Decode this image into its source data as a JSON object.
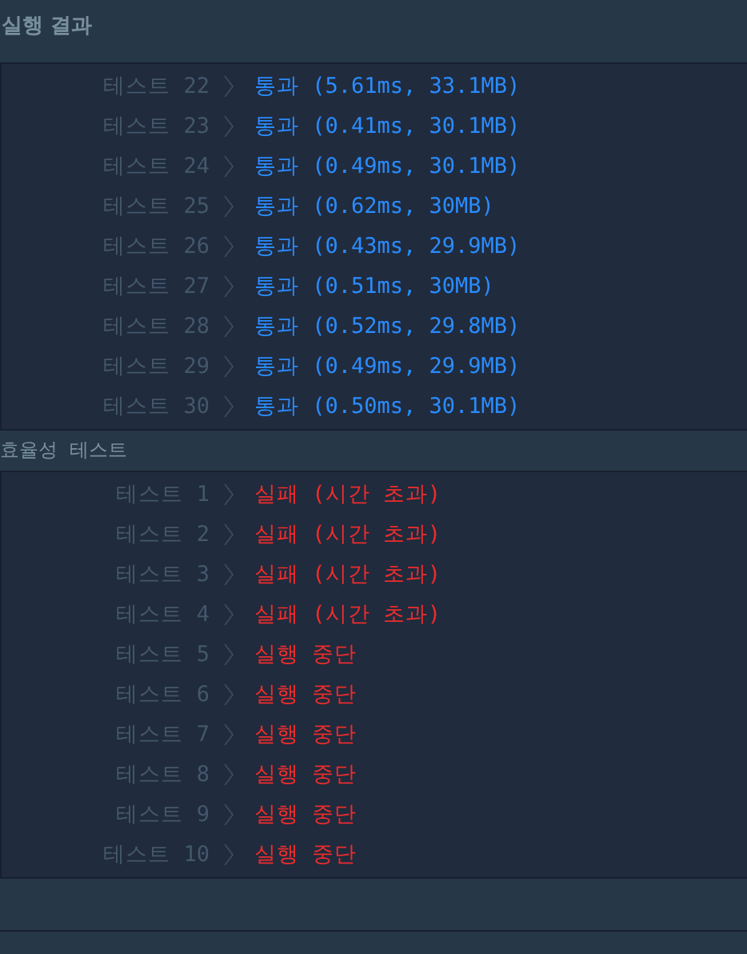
{
  "header": {
    "title": "실행 결과"
  },
  "sections": [
    {
      "tests": [
        {
          "label": "테스트 22",
          "kind": "pass",
          "result": "통과 (5.61ms, 33.1MB)"
        },
        {
          "label": "테스트 23",
          "kind": "pass",
          "result": "통과 (0.41ms, 30.1MB)"
        },
        {
          "label": "테스트 24",
          "kind": "pass",
          "result": "통과 (0.49ms, 30.1MB)"
        },
        {
          "label": "테스트 25",
          "kind": "pass",
          "result": "통과 (0.62ms, 30MB)"
        },
        {
          "label": "테스트 26",
          "kind": "pass",
          "result": "통과 (0.43ms, 29.9MB)"
        },
        {
          "label": "테스트 27",
          "kind": "pass",
          "result": "통과 (0.51ms, 30MB)"
        },
        {
          "label": "테스트 28",
          "kind": "pass",
          "result": "통과 (0.52ms, 29.8MB)"
        },
        {
          "label": "테스트 29",
          "kind": "pass",
          "result": "통과 (0.49ms, 29.9MB)"
        },
        {
          "label": "테스트 30",
          "kind": "pass",
          "result": "통과 (0.50ms, 30.1MB)"
        }
      ]
    },
    {
      "title": "효율성  테스트",
      "tests": [
        {
          "label": "테스트 1",
          "kind": "fail",
          "result": "실패 (시간 초과)"
        },
        {
          "label": "테스트 2",
          "kind": "fail",
          "result": "실패 (시간 초과)"
        },
        {
          "label": "테스트 3",
          "kind": "fail",
          "result": "실패 (시간 초과)"
        },
        {
          "label": "테스트 4",
          "kind": "fail",
          "result": "실패 (시간 초과)"
        },
        {
          "label": "테스트 5",
          "kind": "fail",
          "result": "실행 중단"
        },
        {
          "label": "테스트 6",
          "kind": "fail",
          "result": "실행 중단"
        },
        {
          "label": "테스트 7",
          "kind": "fail",
          "result": "실행 중단"
        },
        {
          "label": "테스트 8",
          "kind": "fail",
          "result": "실행 중단"
        },
        {
          "label": "테스트 9",
          "kind": "fail",
          "result": "실행 중단"
        },
        {
          "label": "테스트 10",
          "kind": "fail",
          "result": "실행 중단"
        }
      ]
    }
  ]
}
